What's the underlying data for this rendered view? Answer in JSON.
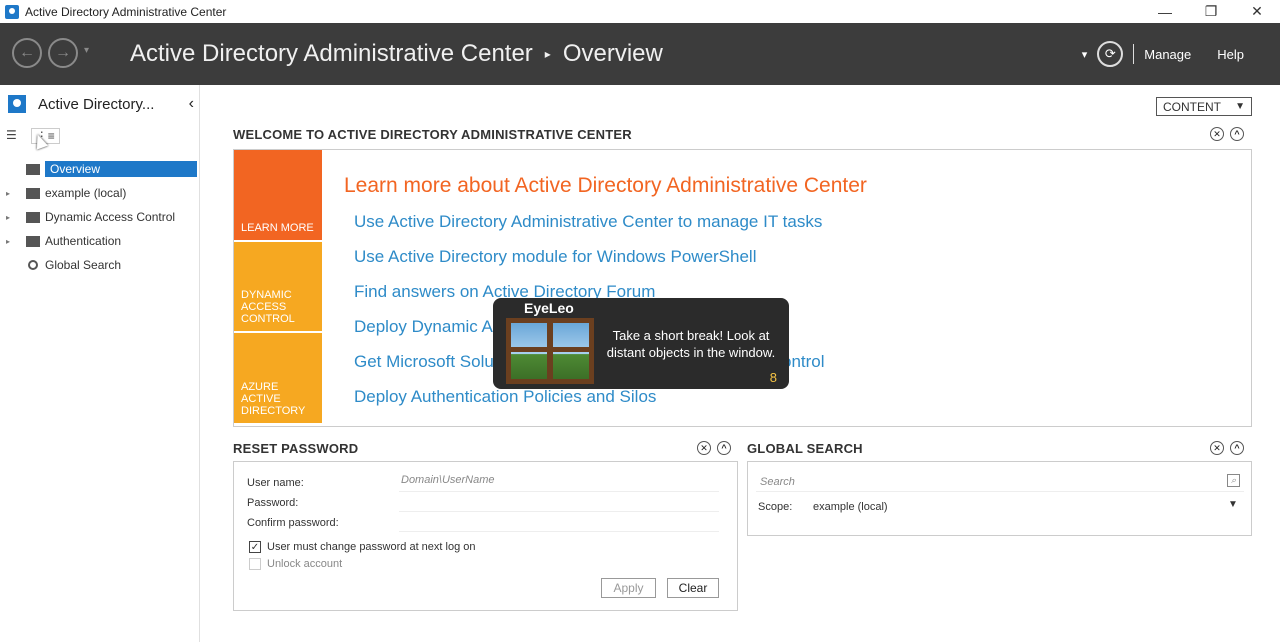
{
  "window": {
    "title": "Active Directory Administrative Center",
    "minimize": "—",
    "maximize": "❐",
    "close": "✕"
  },
  "header": {
    "back": "←",
    "forward": "→",
    "history": "▾",
    "breadcrumb_root": "Active Directory Administrative Center",
    "breadcrumb_sep": "▸",
    "breadcrumb_current": "Overview",
    "dropdown": "▾",
    "refresh": "⟳",
    "manage": "Manage",
    "help": "Help"
  },
  "sidebar": {
    "title": "Active Directory...",
    "collapse": "‹",
    "list_view": "☰",
    "tree_view": "⋮≡",
    "items": [
      {
        "label": "Overview",
        "selected": true
      },
      {
        "label": "example (local)",
        "expander": "▸"
      },
      {
        "label": "Dynamic Access Control",
        "expander": "▸"
      },
      {
        "label": "Authentication",
        "expander": "▸"
      },
      {
        "label": "Global Search"
      }
    ]
  },
  "content": {
    "content_button": "CONTENT",
    "content_arrow": "▼",
    "close_glyph": "✕",
    "up_glyph": "^",
    "welcome": {
      "title": "WELCOME TO ACTIVE DIRECTORY ADMINISTRATIVE CENTER",
      "tiles": [
        "LEARN MORE",
        "DYNAMIC\nACCESS\nCONTROL",
        "AZURE\nACTIVE\nDIRECTORY"
      ],
      "learn_title": "Learn more about Active Directory Administrative Center",
      "links": [
        "Use Active Directory Administrative Center to manage IT tasks",
        "Use Active Directory module for Windows PowerShell",
        "Find answers on Active Directory Forum",
        "Deploy Dynamic Access Control",
        "Get Microsoft Solution Accelerator for Dynamic Access Control",
        "Deploy Authentication Policies and Silos"
      ]
    },
    "reset_password": {
      "title": "RESET PASSWORD",
      "username_label": "User name:",
      "username_placeholder": "Domain\\UserName",
      "password_label": "Password:",
      "confirm_label": "Confirm password:",
      "must_change_label": "User must change password at next log on",
      "check_mark": "✓",
      "unlock_label": "Unlock account",
      "apply": "Apply",
      "clear": "Clear"
    },
    "global_search": {
      "title": "GLOBAL SEARCH",
      "search_placeholder": "Search",
      "search_icon": "⌕",
      "scope_label": "Scope:",
      "scope_value": "example (local)",
      "scope_arrow": "▼"
    }
  },
  "eyeleo": {
    "name": "EyeLeo",
    "message": "Take a short break! Look at distant objects in the window.",
    "countdown": "8"
  }
}
